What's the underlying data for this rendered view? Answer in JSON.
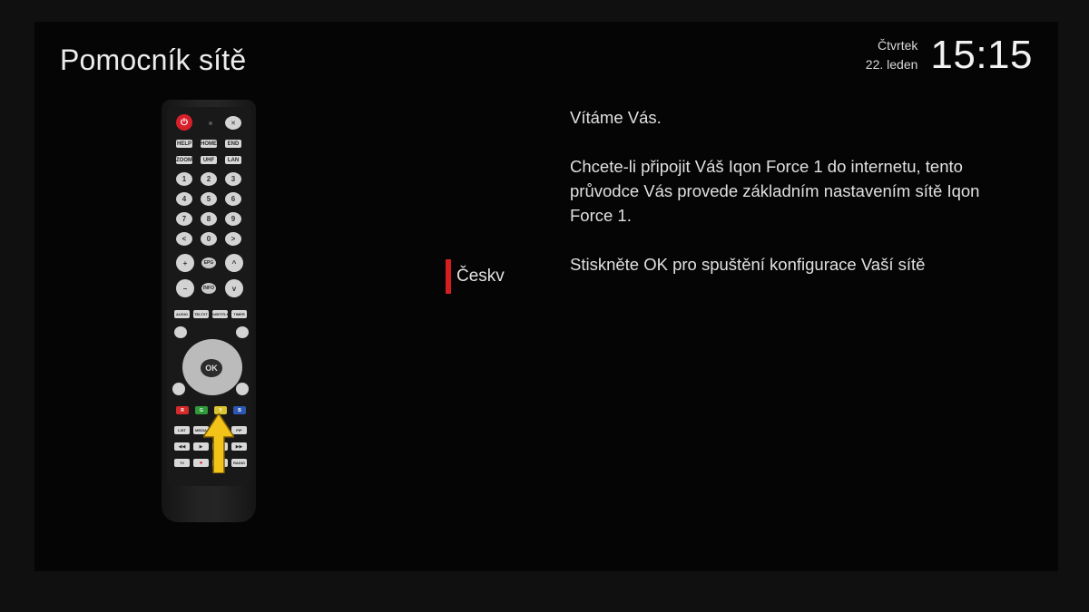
{
  "header": {
    "title": "Pomocník sítě",
    "day": "Čtvrtek",
    "date": "22. leden",
    "time": "15:15"
  },
  "remote": {
    "row1": [
      "HELP",
      "HOME",
      "END"
    ],
    "row2": [
      "ZOOM",
      "UHF",
      "LAN"
    ],
    "digits": [
      "1",
      "2",
      "3",
      "4",
      "5",
      "6",
      "7",
      "8",
      "9",
      "<",
      "0",
      ">"
    ],
    "side_left": [
      "+",
      "EPG",
      "^"
    ],
    "side_left2": [
      "–",
      "INFO",
      "v"
    ],
    "function_row": [
      "AUDIO",
      "TELTXT",
      "SUBTITLE",
      "TIMER"
    ],
    "ok_label": "OK",
    "colors": [
      {
        "label": "R",
        "color": "#d52a2a"
      },
      {
        "label": "G",
        "color": "#2f9a3a"
      },
      {
        "label": "Y",
        "color": "#d9c531"
      },
      {
        "label": "B",
        "color": "#2c58b4"
      }
    ],
    "bottom_row1": [
      "LIST",
      "MEDIA",
      "",
      "PIP"
    ],
    "bottom_row2": [
      "◀◀",
      "▶",
      "II",
      "▶▶"
    ],
    "bottom_row3": [
      "TV",
      "●",
      "■",
      "RADIO"
    ],
    "arrow_color": "#f2c41a"
  },
  "language": {
    "selected": "Českv",
    "accent_color": "#d51f1f"
  },
  "message": {
    "line1": "Vítáme Vás.",
    "line2": "Chcete-li připojit Váš Iqon Force 1 do internetu, tento průvodce Vás provede základním nastavením sítě Iqon Force 1.",
    "line3": "Stiskněte OK pro spuštění konfigurace Vaší sítě"
  }
}
